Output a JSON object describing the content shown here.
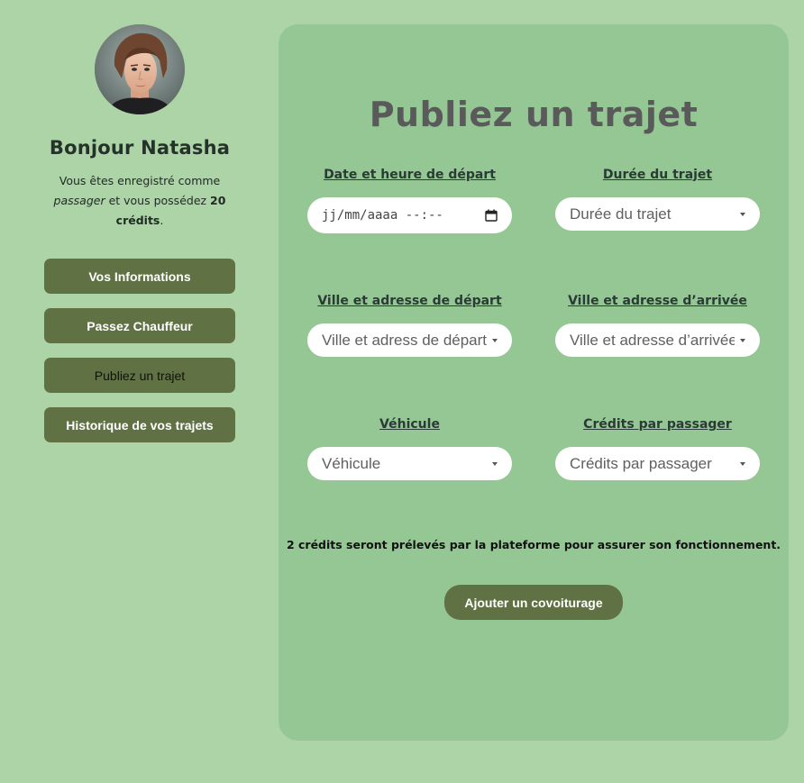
{
  "sidebar": {
    "greeting": "Bonjour Natasha",
    "status": {
      "prefix": "Vous êtes enregistré comme ",
      "role": "passager",
      "middle": " et vous possédez ",
      "credits": "20 crédits",
      "suffix": "."
    },
    "buttons": [
      {
        "label": "Vos Informations"
      },
      {
        "label": "Passez Chauffeur"
      },
      {
        "label": "Publiez un trajet"
      },
      {
        "label": "Historique de vos trajets"
      }
    ]
  },
  "form": {
    "title": "Publiez un trajet",
    "fields": {
      "date": {
        "label": "Date et heure de départ",
        "placeholder": "jj/mm/aaaa --:--"
      },
      "duree": {
        "label": "Durée du trajet",
        "placeholder": "Durée du trajet"
      },
      "depart": {
        "label": "Ville et adresse de départ",
        "placeholder": "Ville et adress de départ"
      },
      "arrivee": {
        "label": "Ville et adresse d’arrivée",
        "placeholder": "Ville et adresse d’arrivée"
      },
      "vehicule": {
        "label": "Véhicule",
        "placeholder": "Véhicule"
      },
      "credits": {
        "label": "Crédits par passager",
        "placeholder": "Crédits par passager"
      }
    },
    "notice": "2 crédits seront prélevés par la plateforme pour assurer son fonctionnement.",
    "submit_label": "Ajouter un covoiturage"
  },
  "colors": {
    "background": "#acd4a6",
    "card": "#95c795",
    "button": "#607244"
  }
}
